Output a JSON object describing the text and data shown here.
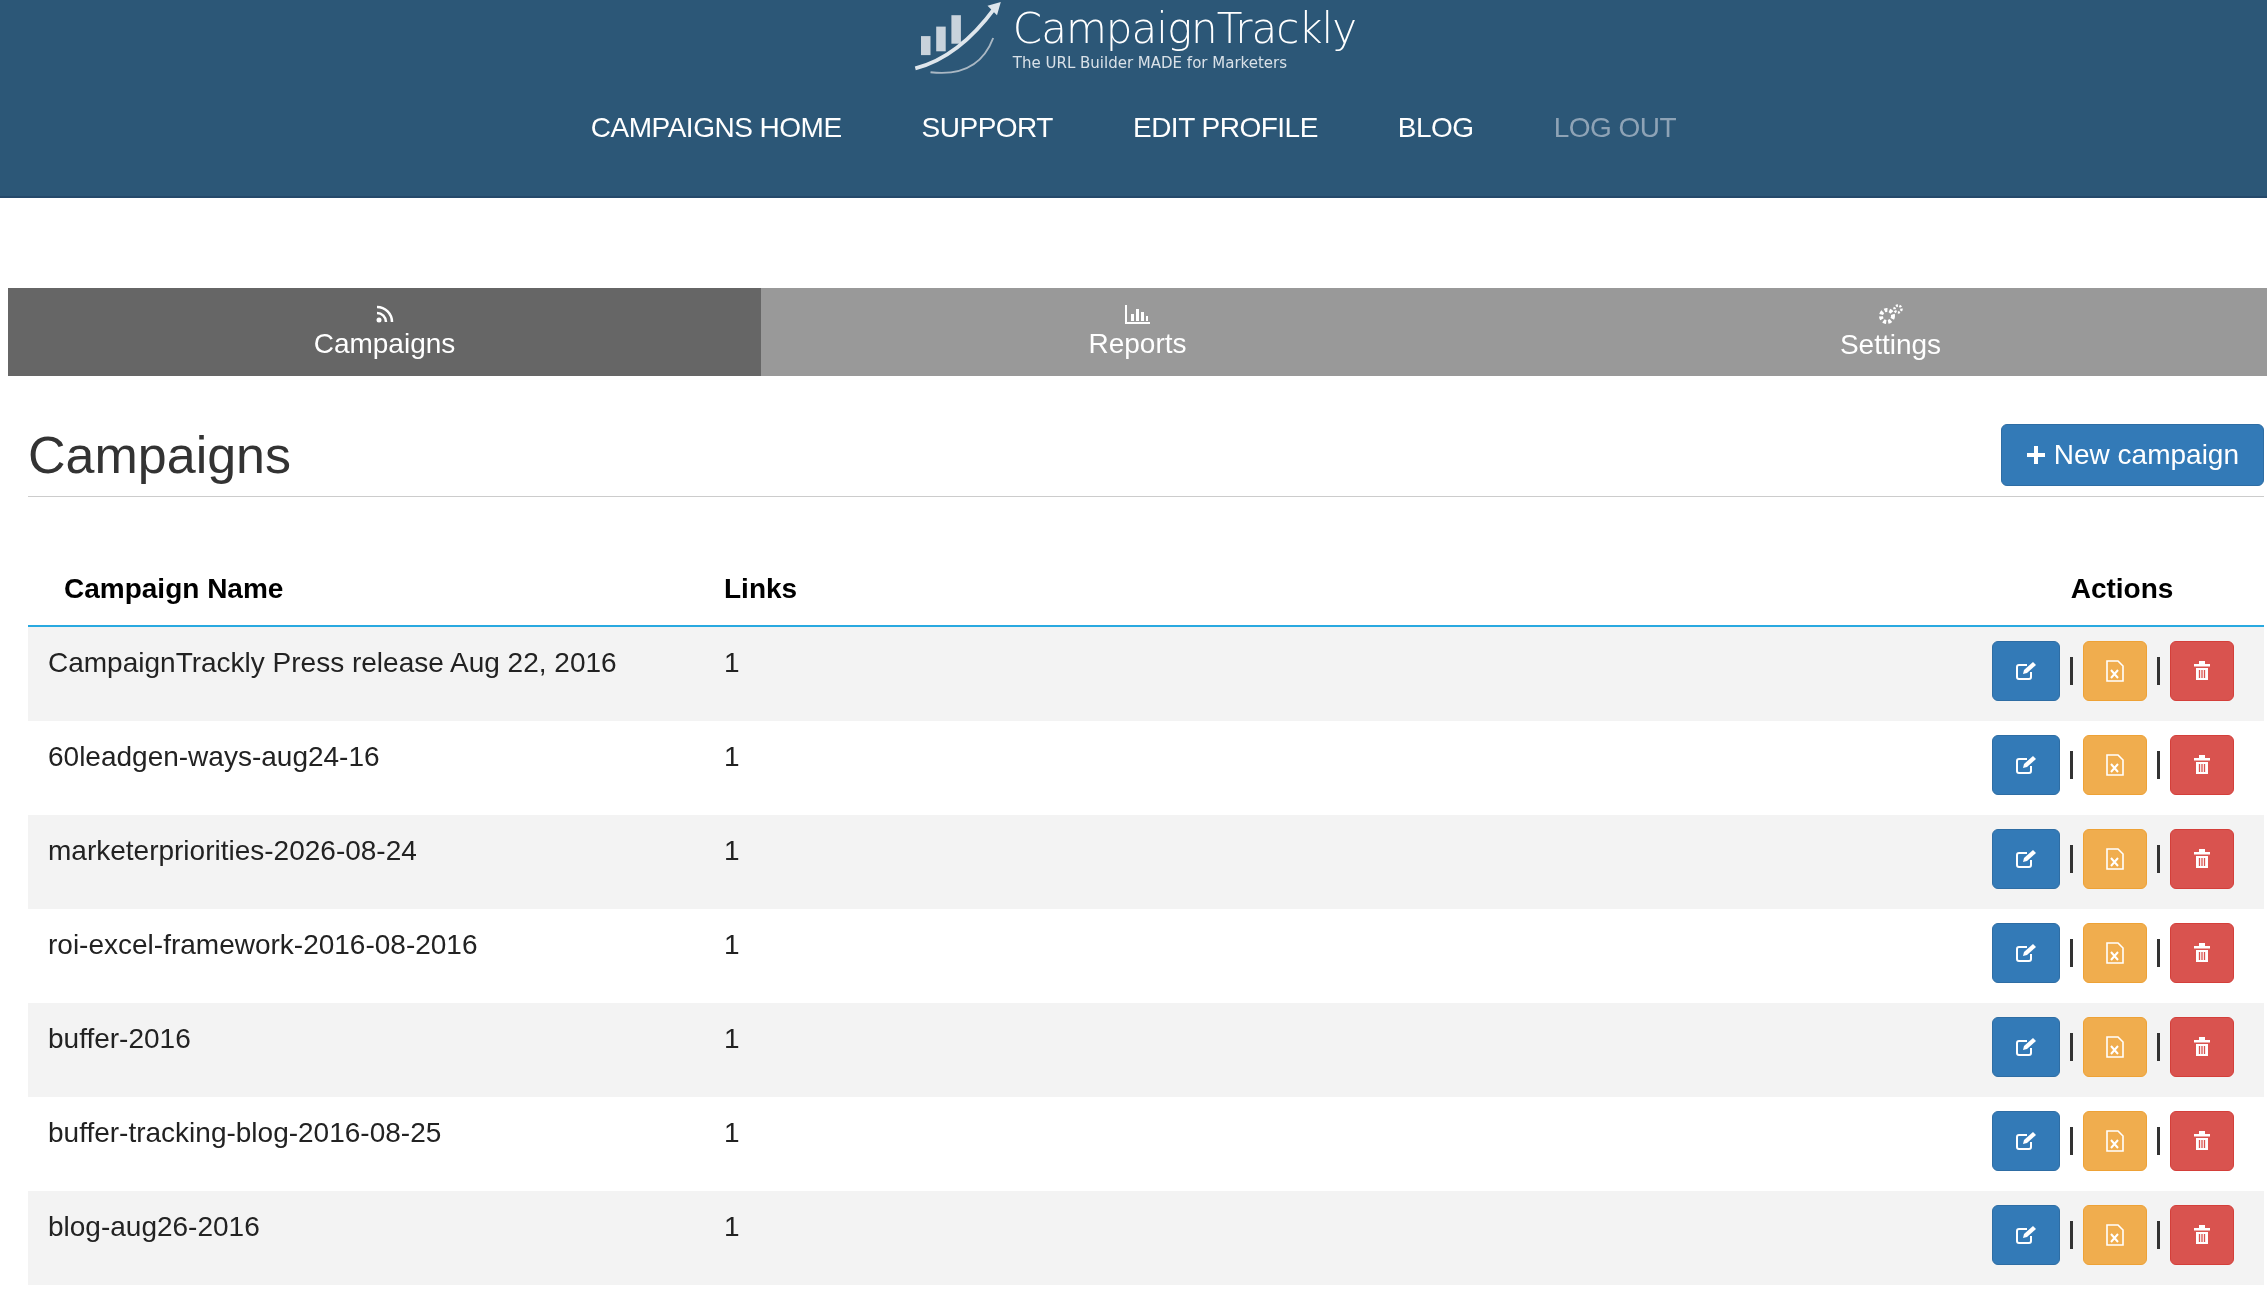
{
  "header": {
    "logo_title": "CampaignTrackly",
    "logo_tagline": "The URL Builder MADE for Marketers",
    "nav": [
      {
        "label": "CAMPAIGNS HOME",
        "muted": false
      },
      {
        "label": "SUPPORT",
        "muted": false
      },
      {
        "label": "EDIT PROFILE",
        "muted": false
      },
      {
        "label": "BLOG",
        "muted": false
      },
      {
        "label": "LOG OUT",
        "muted": true
      }
    ]
  },
  "tabs": [
    {
      "label": "Campaigns",
      "kind": "feed",
      "selected": true
    },
    {
      "label": "Reports",
      "kind": "chart",
      "selected": false
    },
    {
      "label": "Settings",
      "kind": "gears",
      "selected": false
    }
  ],
  "page_title": "Campaigns",
  "new_button": "New campaign",
  "table": {
    "columns": [
      "Campaign Name",
      "Links",
      "Actions"
    ],
    "rows": [
      {
        "name": "CampaignTrackly Press release Aug 22, 2016",
        "links": "1"
      },
      {
        "name": "60leadgen-ways-aug24-16",
        "links": "1"
      },
      {
        "name": "marketerpriorities-2026-08-24",
        "links": "1"
      },
      {
        "name": "roi-excel-framework-2016-08-2016",
        "links": "1"
      },
      {
        "name": "buffer-2016",
        "links": "1"
      },
      {
        "name": "buffer-tracking-blog-2016-08-25",
        "links": "1"
      },
      {
        "name": "blog-aug26-2016",
        "links": "1"
      }
    ]
  }
}
